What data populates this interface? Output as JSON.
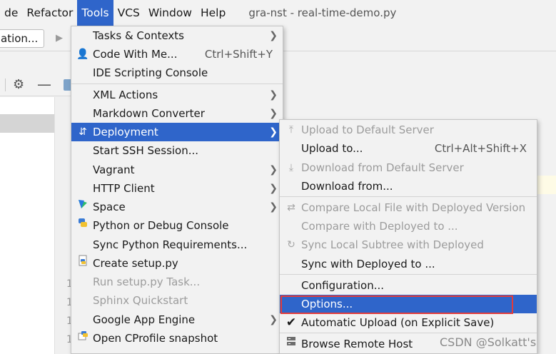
{
  "menubar": {
    "items": [
      "de",
      "Refactor",
      "Tools",
      "VCS",
      "Window",
      "Help"
    ],
    "active_index": 2,
    "title": "gra-nst - real-time-demo.py"
  },
  "toolbar": {
    "run_config": "ation..."
  },
  "gutter": {
    "line_numbers": [
      "1",
      "1",
      "1",
      "1"
    ]
  },
  "tools_menu": {
    "items": [
      {
        "label": "Tasks & Contexts",
        "submenu": true
      },
      {
        "label": "Code With Me...",
        "shortcut": "Ctrl+Shift+Y",
        "icon": "user-icon"
      },
      {
        "label": "IDE Scripting Console"
      },
      {
        "label": "XML Actions",
        "submenu": true
      },
      {
        "label": "Markdown Converter",
        "submenu": true
      },
      {
        "label": "Deployment",
        "submenu": true,
        "highlighted": true,
        "icon": "deploy-icon"
      },
      {
        "label": "Start SSH Session..."
      },
      {
        "label": "Vagrant",
        "submenu": true
      },
      {
        "label": "HTTP Client",
        "submenu": true
      },
      {
        "label": "Space",
        "submenu": true,
        "icon": "space-icon"
      },
      {
        "label": "Python or Debug Console",
        "icon": "python-icon"
      },
      {
        "label": "Sync Python Requirements..."
      },
      {
        "label": "Create setup.py",
        "icon": "python-file-icon"
      },
      {
        "label": "Run setup.py Task...",
        "disabled": true
      },
      {
        "label": "Sphinx Quickstart",
        "disabled": true
      },
      {
        "label": "Google App Engine",
        "submenu": true
      },
      {
        "label": "Open CProfile snapshot",
        "icon": "profile-icon"
      }
    ]
  },
  "deployment_menu": {
    "items": [
      {
        "label": "Upload to Default Server",
        "disabled": true,
        "icon": "upload-icon"
      },
      {
        "label": "Upload to...",
        "shortcut": "Ctrl+Alt+Shift+X"
      },
      {
        "label": "Download from Default Server",
        "disabled": true,
        "icon": "download-icon"
      },
      {
        "label": "Download from..."
      },
      {
        "label": "Compare Local File with Deployed Version",
        "disabled": true,
        "icon": "compare-icon"
      },
      {
        "label": "Compare with Deployed to ...",
        "disabled": true
      },
      {
        "label": "Sync Local Subtree with Deployed",
        "disabled": true,
        "icon": "sync-icon"
      },
      {
        "label": "Sync with Deployed to ..."
      },
      {
        "label": "Configuration..."
      },
      {
        "label": "Options...",
        "highlighted": true
      },
      {
        "label": "Automatic Upload (on Explicit Save)",
        "checked": true,
        "icon": "check-icon"
      },
      {
        "label": "Browse Remote Host",
        "icon": "server-icon"
      }
    ]
  },
  "watermark": "CSDN @Solkatt's",
  "colors": {
    "highlight": "#2f65ca",
    "annotation_box": "#e23b3b"
  }
}
